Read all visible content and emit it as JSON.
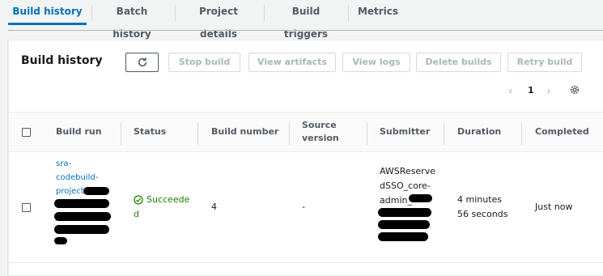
{
  "tabs": [
    {
      "label": "Build history",
      "active": true
    },
    {
      "label": "Batch history",
      "active": false
    },
    {
      "label": "Project details",
      "active": false
    },
    {
      "label": "Build triggers",
      "active": false
    },
    {
      "label": "Metrics",
      "active": false
    }
  ],
  "panel": {
    "title": "Build history",
    "buttons": {
      "refresh_icon": "refresh-icon",
      "stop_build": "Stop build",
      "view_artifacts": "View artifacts",
      "view_logs": "View logs",
      "delete_builds": "Delete builds",
      "retry_build": "Retry build"
    },
    "pagination": {
      "page": "1",
      "prev_icon": "chevron-left-icon",
      "next_icon": "chevron-right-icon"
    },
    "settings_icon": "gear-icon"
  },
  "table": {
    "columns": [
      "Build run",
      "Status",
      "Build number",
      "Source version",
      "Submitter",
      "Duration",
      "Completed"
    ],
    "source_version_lines": [
      "Source",
      "version"
    ],
    "rows": [
      {
        "build_run_lines": [
          "sra-",
          "codebuild-",
          "project-"
        ],
        "status_icon": "check-circle-icon",
        "status_lines": [
          "Succeede",
          "d"
        ],
        "build_number": "4",
        "source_version": "-",
        "submitter_lines": [
          "AWSReserve",
          "dSSO_core-",
          "admin_"
        ],
        "duration_lines": [
          "4 minutes",
          "56 seconds"
        ],
        "completed": "Just now"
      }
    ]
  },
  "colors": {
    "accent": "#0073bb",
    "success": "#1d8102",
    "disabled": "#aab7b8"
  }
}
